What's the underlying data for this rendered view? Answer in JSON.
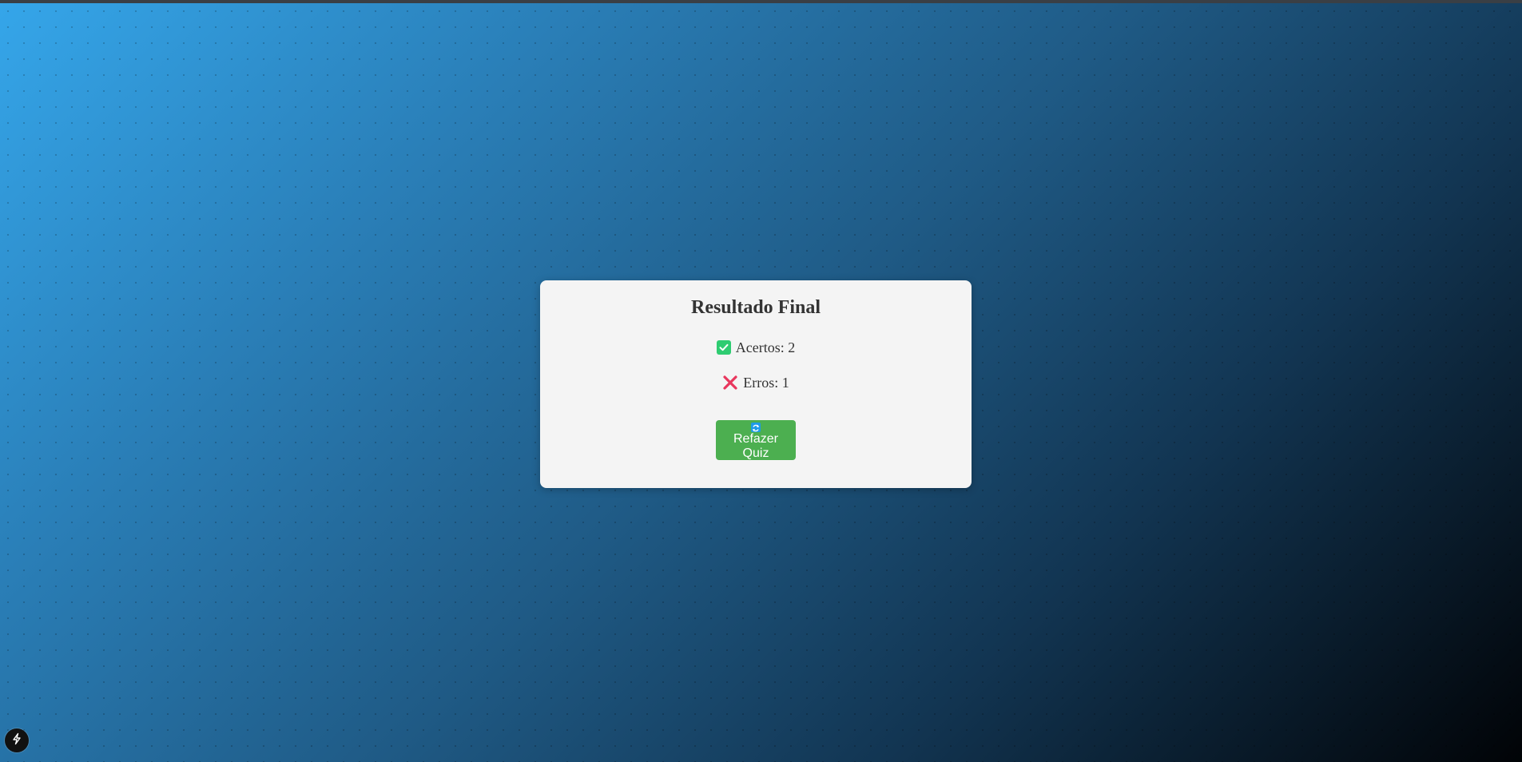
{
  "result": {
    "title": "Resultado Final",
    "hits_text": "Acertos: 2",
    "errors_text": "Erros: 1",
    "retry_label": "Refazer Quiz"
  },
  "icons": {
    "hits": "checkbox-check-icon",
    "errors": "cross-x-icon",
    "retry": "refresh-icon",
    "corner": "lightning-bolt-icon"
  },
  "colors": {
    "card_background": "#f4f4f4",
    "button_background": "#4caf50",
    "check_color": "#2ecc71",
    "cross_color": "#e8365d",
    "gradient_start": "#35a6ea",
    "gradient_end": "#010306"
  }
}
